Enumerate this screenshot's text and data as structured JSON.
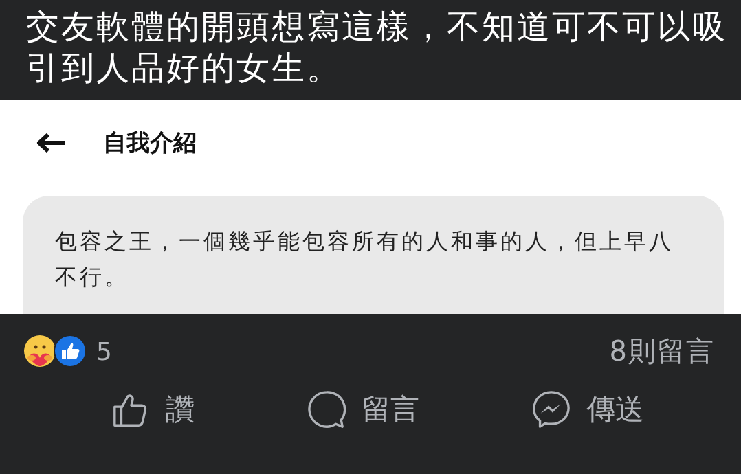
{
  "post": {
    "caption": "交友軟體的開頭想寫這樣，不知道可不可以吸引到人品好的女生。"
  },
  "shared_image": {
    "header_title": "自我介紹",
    "bio_text": "包容之王，一個幾乎能包容所有的人和事的人，但上早八不行。"
  },
  "reactions": {
    "count": "5",
    "comments": "8則留言"
  },
  "actions": [
    {
      "kind": "like",
      "label": "讚"
    },
    {
      "kind": "comment",
      "label": "留言"
    },
    {
      "kind": "send",
      "label": "傳送"
    }
  ]
}
